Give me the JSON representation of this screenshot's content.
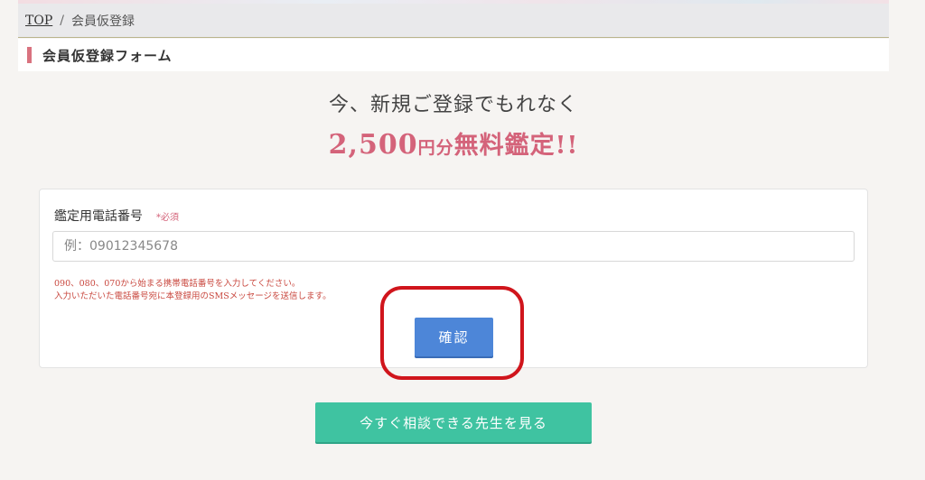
{
  "breadcrumb": {
    "home": "TOP",
    "separator": "/",
    "current": "会員仮登録"
  },
  "section": {
    "title": "会員仮登録フォーム",
    "accent_color": "#d9727f"
  },
  "promo": {
    "lead": "今、新規ご登録でもれなく",
    "amount": "2,500",
    "unit": "円分",
    "offer": "無料鑑定!!",
    "color": "#d4637a"
  },
  "form": {
    "phone_label": "鑑定用電話番号",
    "required_mark": "*必須",
    "phone_placeholder": "例：09012345678",
    "phone_value": "",
    "note_line1": "090、080、070から始まる携帯電話番号を入力してください。",
    "note_line2": "入力いただいた電話番号宛に本登録用のSMSメッセージを送信します。",
    "confirm_label": "確認",
    "confirm_color": "#4d86d8"
  },
  "cta": {
    "teachers_label": "今すぐ相談できる先生を見る",
    "color": "#3fc3a1"
  },
  "annotation": {
    "highlight_color": "#d0151c"
  }
}
